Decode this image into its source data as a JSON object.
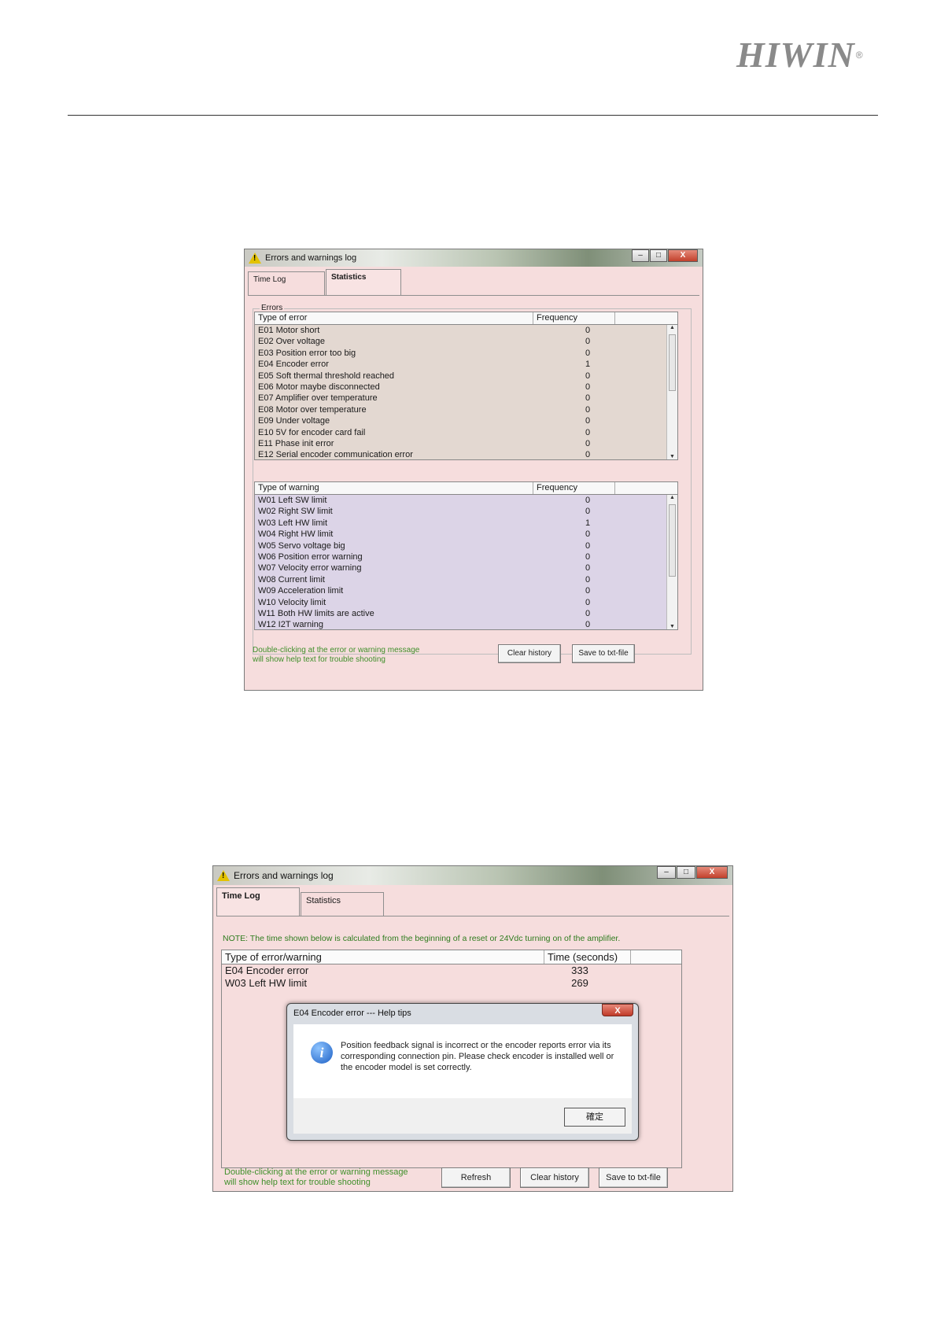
{
  "brand": {
    "name": "HIWIN",
    "reg": "®"
  },
  "win1": {
    "title": "Errors and warnings log",
    "tabs": [
      "Time Log",
      "Statistics"
    ],
    "group_label": "Errors",
    "errors": {
      "headers": [
        "Type of error",
        "Frequency"
      ],
      "rows": [
        {
          "label": "E01 Motor short",
          "freq": "0"
        },
        {
          "label": "E02 Over voltage",
          "freq": "0"
        },
        {
          "label": "E03 Position error too big",
          "freq": "0"
        },
        {
          "label": "E04 Encoder error",
          "freq": "1"
        },
        {
          "label": "E05 Soft thermal threshold reached",
          "freq": "0"
        },
        {
          "label": "E06 Motor maybe disconnected",
          "freq": "0"
        },
        {
          "label": "E07 Amplifier over temperature",
          "freq": "0"
        },
        {
          "label": "E08 Motor over temperature",
          "freq": "0"
        },
        {
          "label": "E09 Under voltage",
          "freq": "0"
        },
        {
          "label": "E10 5V for encoder card fail",
          "freq": "0"
        },
        {
          "label": "E11 Phase init error",
          "freq": "0"
        },
        {
          "label": "E12 Serial encoder communication error",
          "freq": "0"
        }
      ]
    },
    "warnings": {
      "headers": [
        "Type of warning",
        "Frequency"
      ],
      "rows": [
        {
          "label": "W01 Left SW limit",
          "freq": "0"
        },
        {
          "label": "W02 Right SW limit",
          "freq": "0"
        },
        {
          "label": "W03 Left HW limit",
          "freq": "1"
        },
        {
          "label": "W04 Right HW limit",
          "freq": "0"
        },
        {
          "label": "W05 Servo voltage big",
          "freq": "0"
        },
        {
          "label": "W06 Position error warning",
          "freq": "0"
        },
        {
          "label": "W07 Velocity error warning",
          "freq": "0"
        },
        {
          "label": "W08 Current limit",
          "freq": "0"
        },
        {
          "label": "W09 Acceleration limit",
          "freq": "0"
        },
        {
          "label": "W10 Velocity limit",
          "freq": "0"
        },
        {
          "label": "W11 Both HW limits are active",
          "freq": "0"
        },
        {
          "label": "W12 I2T warning",
          "freq": "0"
        }
      ]
    },
    "hint_lines": [
      "Double-clicking at the error or warning message",
      "will show help text for trouble shooting"
    ],
    "buttons": {
      "clear": "Clear history",
      "save": "Save to txt-file"
    }
  },
  "win2": {
    "title": "Errors and warnings log",
    "tabs": [
      "Time Log",
      "Statistics"
    ],
    "note": "NOTE: The time shown below is calculated from the beginning of a reset or 24Vdc turning on of the amplifier.",
    "log": {
      "headers": [
        "Type of error/warning",
        "Time (seconds)"
      ],
      "rows": [
        {
          "label": "E04 Encoder error",
          "time": "333"
        },
        {
          "label": "W03 Left HW limit",
          "time": "269"
        }
      ]
    },
    "hint_lines": [
      "Double-clicking at the error or warning message",
      "will show help text for trouble shooting"
    ],
    "buttons": {
      "refresh": "Refresh",
      "clear": "Clear history",
      "save": "Save to txt-file"
    }
  },
  "dialog": {
    "title": "E04 Encoder error --- Help tips",
    "message": "Position feedback signal is incorrect or the encoder reports error via its corresponding connection pin. Please check encoder is installed well or the encoder model is set correctly.",
    "ok": "確定",
    "close": "X"
  },
  "window_controls": {
    "minimize": "‒",
    "maximize": "□",
    "close": "X"
  }
}
